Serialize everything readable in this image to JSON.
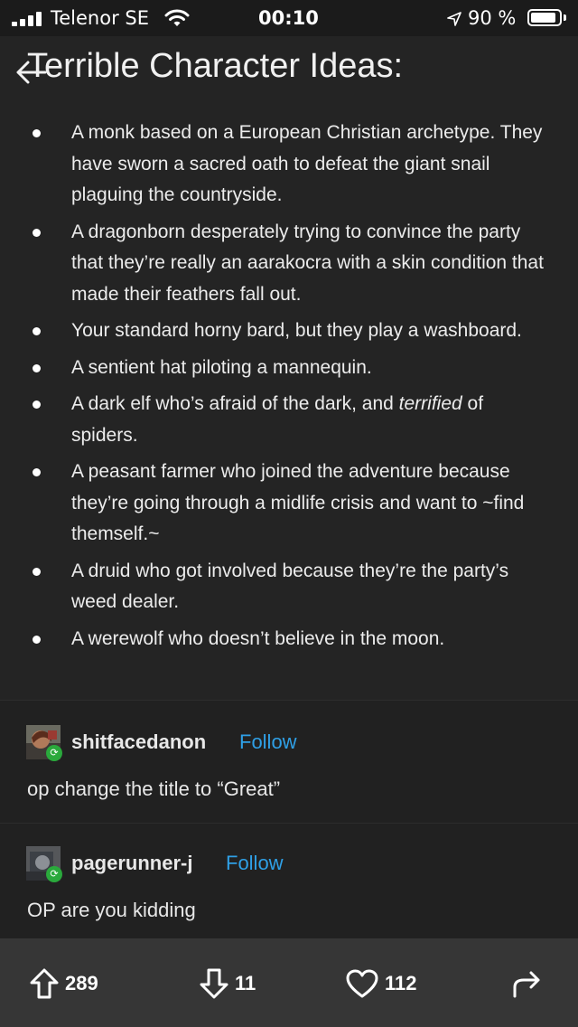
{
  "status_bar": {
    "carrier": "Telenor SE",
    "time": "00:10",
    "battery_percent": "90 %",
    "battery_level": 0.9,
    "icons": [
      "signal-icon",
      "wifi-icon",
      "location-arrow-icon",
      "battery-icon"
    ]
  },
  "post": {
    "title": "Terrible Character Ideas:",
    "ideas": [
      "A monk based on a European Christian archetype. They have sworn a sacred oath to defeat the giant snail plaguing the countryside.",
      "A dragonborn desperately trying to convince the party that they’re really an aarakocra with a skin condition that made their feathers fall out.",
      "Your standard horny bard, but they play a washboard.",
      "A sentient hat piloting a mannequin.",
      "A dark elf who’s afraid of the dark, and",
      "A peasant farmer who joined the adventure because they’re going through a midlife crisis and want to ~find themself.~",
      "A druid who got involved because they’re the party’s weed dealer.",
      "A werewolf who doesn’t believe in the moon."
    ],
    "idea_5_emphasis": "terrified",
    "idea_5_tail": "of spiders."
  },
  "comments": [
    {
      "username": "shitfacedanon",
      "follow_label": "Follow",
      "text": "op change the title to “Great”"
    },
    {
      "username": "pagerunner-j",
      "follow_label": "Follow",
      "text": "OP are you kidding"
    }
  ],
  "actions": {
    "upvotes": "289",
    "downvotes": "11",
    "likes": "112"
  },
  "colors": {
    "background": "#212121",
    "bottom_bar": "#363636",
    "follow_link": "#2fa0e6",
    "reblog_badge": "#2aa93c"
  }
}
